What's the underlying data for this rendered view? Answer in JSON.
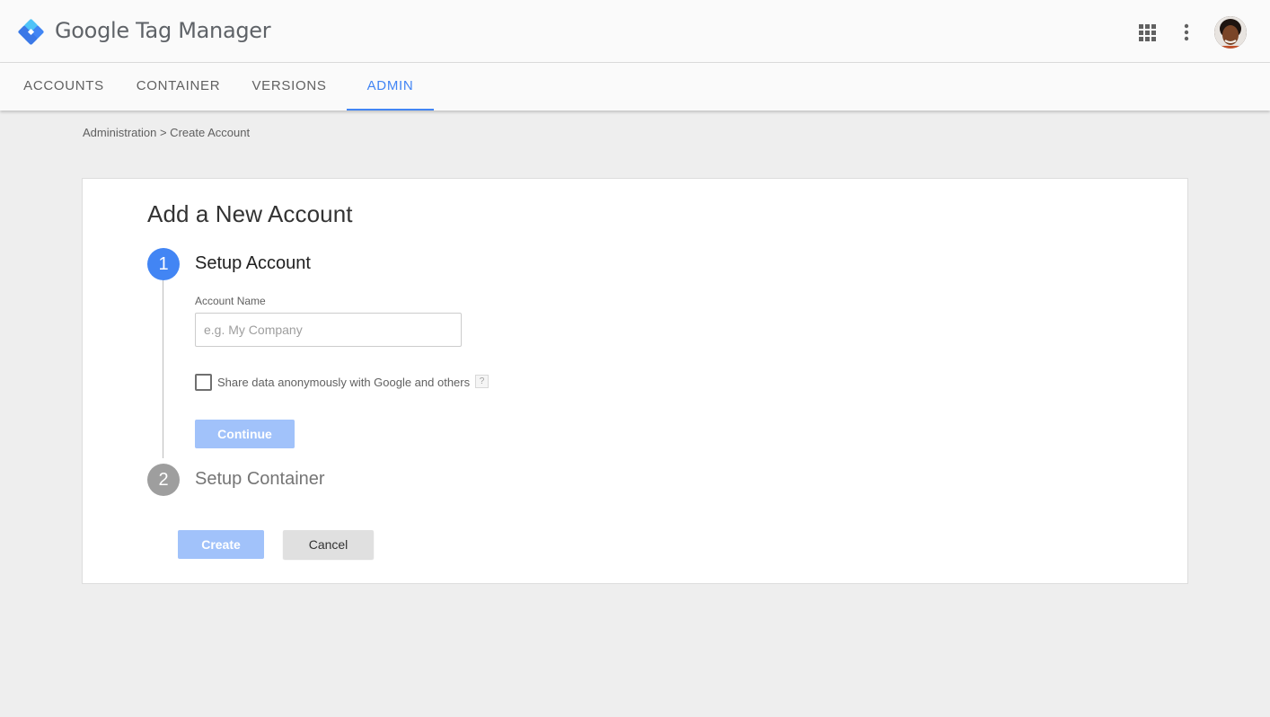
{
  "header": {
    "app_title": "Google Tag Manager",
    "logo_icon": "gtm-diamond-logo-icon",
    "apps_icon": "grid-apps-icon",
    "more_icon": "more-vertical-icon",
    "avatar": "user-avatar"
  },
  "tabs": [
    {
      "label": "ACCOUNTS",
      "active": false
    },
    {
      "label": "CONTAINER",
      "active": false
    },
    {
      "label": "VERSIONS",
      "active": false
    },
    {
      "label": "ADMIN",
      "active": true
    }
  ],
  "breadcrumb": "Administration > Create Account",
  "card": {
    "title": "Add a New Account",
    "step1": {
      "number": "1",
      "title": "Setup Account",
      "field_label": "Account Name",
      "field_value": "",
      "field_placeholder": "e.g. My Company",
      "checkbox_label": "Share data anonymously with Google and others",
      "checkbox_checked": false,
      "help_glyph": "?",
      "continue_label": "Continue"
    },
    "step2": {
      "number": "2",
      "title": "Setup Container"
    },
    "create_label": "Create",
    "cancel_label": "Cancel"
  },
  "colors": {
    "accent": "#4285f4",
    "disabled_primary": "#a1c2fa",
    "inactive_step": "#9e9e9e",
    "background": "#eeeeee"
  }
}
